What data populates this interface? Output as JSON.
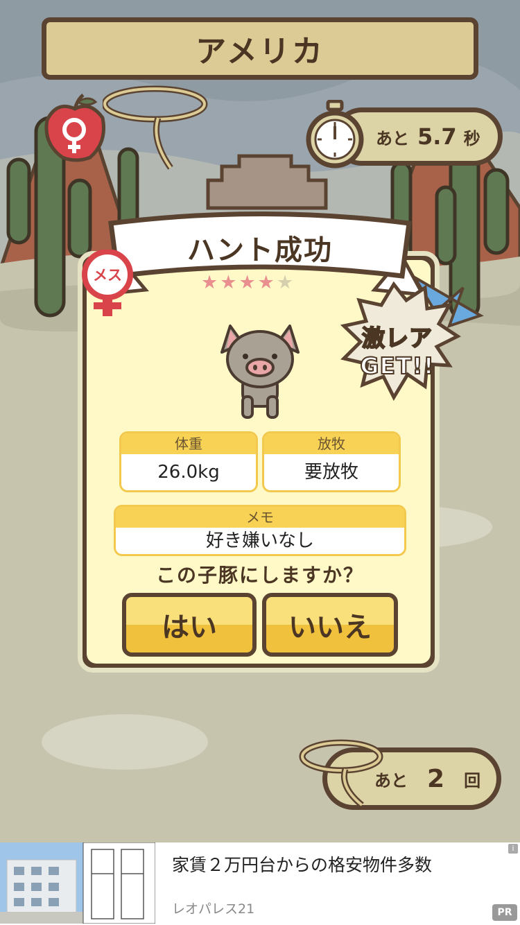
{
  "header": {
    "title": "アメリカ"
  },
  "timer": {
    "prefix": "あと",
    "value": "5.7",
    "suffix": "秒"
  },
  "result": {
    "title": "ハント成功",
    "gender_badge": "メス",
    "stars_filled": 4,
    "stars_total": 5,
    "rare_badge_line1": "激レア",
    "rare_badge_line2": "GET!!",
    "weight_label": "体重",
    "weight_value": "26.0kg",
    "pasture_label": "放牧",
    "pasture_value": "要放牧",
    "memo_label": "メモ",
    "memo_value": "好き嫌いなし",
    "question": "この子豚にしますか？",
    "yes_label": "はい",
    "no_label": "いいえ"
  },
  "remaining": {
    "prefix": "あと",
    "value": "2",
    "suffix": "回"
  },
  "ad": {
    "title": "家賃２万円台からの格安物件多数",
    "sponsor": "レオパレス21",
    "info": "i",
    "pr": "PR"
  },
  "colors": {
    "wood_dark": "#5b4331",
    "panel": "#fff9c8",
    "accent_yellow": "#f7d254",
    "star_pink": "#e98f8f",
    "female_red": "#d9434a"
  }
}
